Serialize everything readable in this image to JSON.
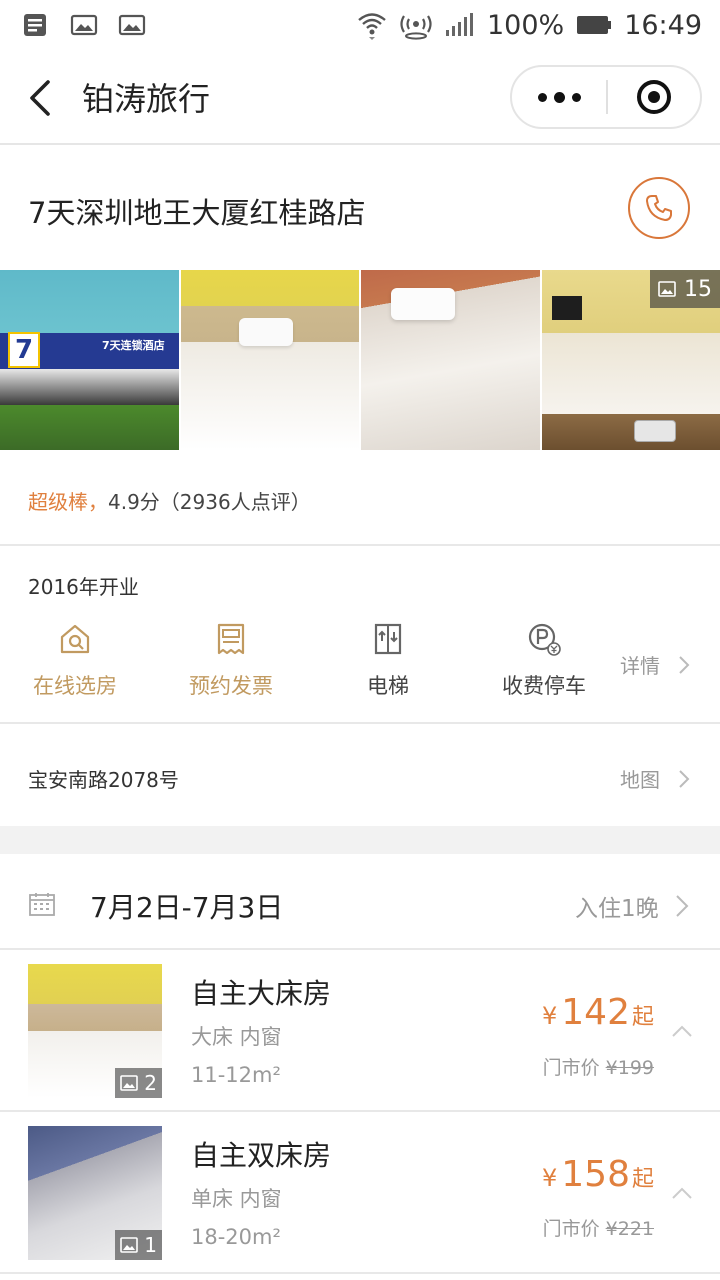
{
  "status_bar": {
    "battery": "100%",
    "time": "16:49"
  },
  "nav": {
    "title": "铂涛旅行"
  },
  "hotel": {
    "name": "7天深圳地王大厦红桂路店",
    "photo_count": "15",
    "sign_text": "7天连锁酒店",
    "sign_number": "7",
    "rating_label": "超级棒，",
    "rating_score": "4.9分（2936人点评）",
    "opened": "2016年开业",
    "facilities": [
      {
        "label": "在线选房",
        "icon": "house-search-icon"
      },
      {
        "label": "预约发票",
        "icon": "invoice-icon"
      },
      {
        "label": "电梯",
        "icon": "elevator-icon"
      },
      {
        "label": "收费停车",
        "icon": "parking-icon"
      }
    ],
    "detail_label": "详情",
    "address": "宝安南路2078号",
    "map_label": "地图"
  },
  "booking": {
    "dates": "7月2日-7月3日",
    "nights": "入住1晚"
  },
  "rooms": [
    {
      "name": "自主大床房",
      "bed": "大床 内窗",
      "size": "11-12m²",
      "price_symbol": "¥",
      "price": "142",
      "price_suffix": "起",
      "orig_label": "门市价",
      "orig_price": "¥199",
      "photo_count": "2"
    },
    {
      "name": "自主双床房",
      "bed": "单床 内窗",
      "size": "18-20m²",
      "price_symbol": "¥",
      "price": "158",
      "price_suffix": "起",
      "orig_label": "门市价",
      "orig_price": "¥221",
      "photo_count": "1"
    }
  ],
  "colors": {
    "accent": "#e0803e",
    "facility_gold": "#c19a60",
    "phone_ring": "#d9773a"
  }
}
